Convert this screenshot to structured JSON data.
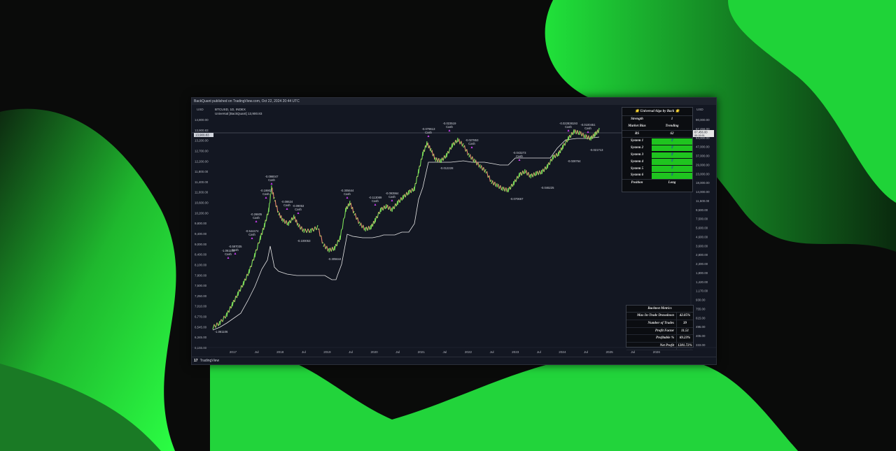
{
  "colors": {
    "green_blob": "#2bff44",
    "chart_bg": "#131722",
    "up_candle": "#7ee35a",
    "down_candle": "#e8876d",
    "white_line": "#e6e6e6",
    "marker": "#c93cf0"
  },
  "header": {
    "published": "BackQuant published on TradingView.com, Oct 22, 2024 20:44 UTC",
    "symbol_line": "BTCUSD, 1D, INDEX",
    "indicator_line": "Universal [BackQuant]  13,900.83",
    "currency_left": "USD",
    "currency_right": "USD"
  },
  "footer": {
    "logo": "17",
    "brand": "TradingView"
  },
  "axes": {
    "left_ticks": [
      "14,800.00",
      "13,900.83",
      "13,200.00",
      "12,700.00",
      "12,200.00",
      "11,800.00",
      "11,400.00",
      "11,000.00",
      "10,600.00",
      "10,200.00",
      "9,800.00",
      "9,400.00",
      "9,000.00",
      "8,400.00",
      "8,100.00",
      "7,800.00",
      "7,500.00",
      "7,250.00",
      "7,010.00",
      "6,770.00",
      "6,545.00",
      "6,345.00",
      "6,155.00"
    ],
    "right_ticks": [
      "90,000.00",
      "67,456.00",
      "54,000.00",
      "47,000.00",
      "37,000.00",
      "29,000.00",
      "23,000.00",
      "18,000.00",
      "14,000.00",
      "11,500.00",
      "9,500.00",
      "7,500.00",
      "5,600.00",
      "4,600.00",
      "3,600.00",
      "2,800.00",
      "2,300.00",
      "1,800.00",
      "1,420.00",
      "1,170.00",
      "930.00",
      "755.00",
      "615.00",
      "495.00",
      "405.00",
      "333.00"
    ],
    "right_price_box": "67,456.00",
    "right_price_sub": "00:15:51",
    "x_ticks": [
      "2017",
      "Jul",
      "2018",
      "Jul",
      "2019",
      "Jul",
      "2020",
      "Jul",
      "2021",
      "Jul",
      "2022",
      "Jul",
      "2023",
      "Jul",
      "2024",
      "Jul",
      "2025",
      "Jul",
      "2026"
    ]
  },
  "annotations": [
    {
      "val": "-0.098047",
      "sub": "Cash"
    },
    {
      "val": "-0.19902",
      "sub": "Cash"
    },
    {
      "val": "-0.08624",
      "sub": "Cash"
    },
    {
      "val": "-0.09053",
      "sub": "Cash"
    },
    {
      "val": "-0.26605",
      "sub": "Cash"
    },
    {
      "val": "-0.544474",
      "sub": "Cash"
    },
    {
      "val": "-1.061106",
      "sub": "Cash"
    },
    {
      "val": "-0.597035",
      "sub": "Cash"
    },
    {
      "val": "-0.305644",
      "sub": "Cash"
    },
    {
      "val": "-0.113089",
      "sub": "Cash"
    },
    {
      "val": "-0.093964",
      "sub": "Cash"
    },
    {
      "val": "-0.079613",
      "sub": "Cash"
    },
    {
      "val": "-0.023519",
      "sub": "Cash"
    },
    {
      "val": "-0.027853",
      "sub": "Cash"
    },
    {
      "val": "-0.043273",
      "sub": "Cash"
    },
    {
      "val": "-0.022838193",
      "sub": "Cash"
    },
    {
      "val": "-0.0100451",
      "sub": "Cash"
    }
  ],
  "low_labels": [
    "-1.061106",
    "-0.305644",
    "-0.100053",
    "-0.012228",
    "-0.070667",
    "-0.046225",
    "-0.028764",
    "-0.021713"
  ],
  "universal_panel": {
    "title": "🌟 Universal Algo by Back 🌟",
    "rows": [
      {
        "k": "Strength",
        "v": "1"
      },
      {
        "k": "Market Bias",
        "v": "Trending"
      },
      {
        "k": "RS",
        "v": "62"
      }
    ],
    "systems": [
      {
        "k": "System 1",
        "v": "⇧"
      },
      {
        "k": "System 2",
        "v": "⇧"
      },
      {
        "k": "System 3",
        "v": "⇧"
      },
      {
        "k": "System 4",
        "v": "⇧"
      },
      {
        "k": "System 5",
        "v": "⇧"
      },
      {
        "k": "System 6",
        "v": "⇧"
      }
    ],
    "position": {
      "k": "Position",
      "v": "Long"
    }
  },
  "backtest_panel": {
    "title": "Backtest Metrics",
    "rows": [
      {
        "k": "Max In-Trade Drawdown",
        "v": "42.05%"
      },
      {
        "k": "Number of Trades",
        "v": "39"
      },
      {
        "k": "Profit Factor",
        "v": "11.51"
      },
      {
        "k": "Profitable %",
        "v": "69.23%"
      },
      {
        "k": "Net Profit",
        "v": "1281.72%"
      }
    ]
  }
}
